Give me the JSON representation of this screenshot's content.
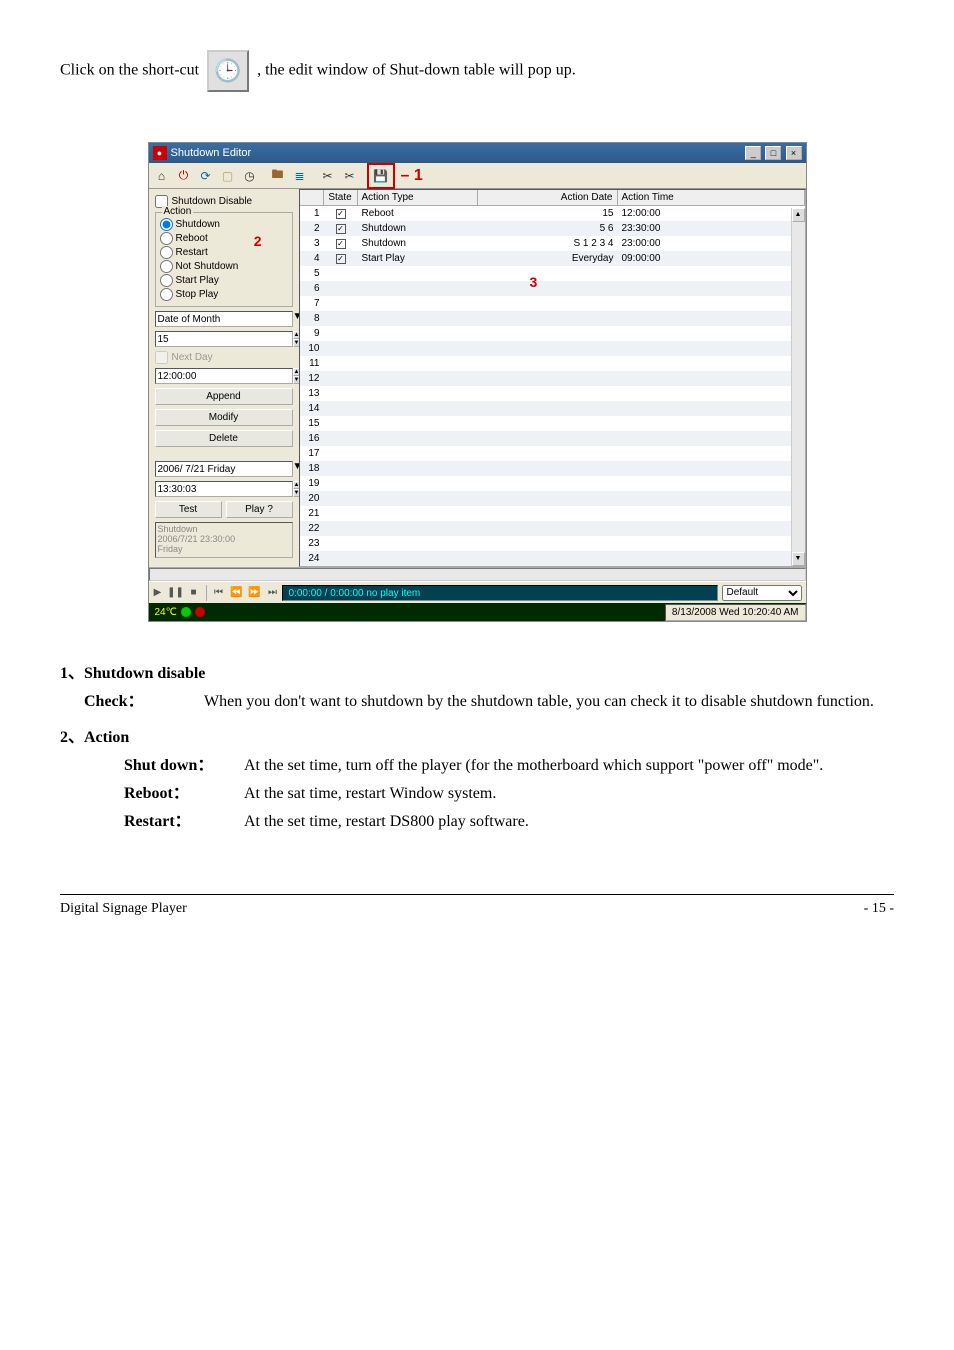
{
  "intro": {
    "prefix": "Click on the short-cut",
    "suffix": ", the edit window of Shut-down table will pop up."
  },
  "clock_icon_glyph": "🕒",
  "window": {
    "title": "Shutdown Editor",
    "toolbar_count": "1"
  },
  "left_panel": {
    "shutdown_disable": "Shutdown Disable",
    "action_legend": "Action",
    "radios": [
      {
        "label": "Shutdown",
        "checked": true
      },
      {
        "label": "Reboot",
        "checked": false
      },
      {
        "label": "Restart",
        "checked": false
      },
      {
        "label": "Not Shutdown",
        "checked": false
      },
      {
        "label": "Start Play",
        "checked": false
      },
      {
        "label": "Stop Play",
        "checked": false
      }
    ],
    "marker2": "2",
    "period_select": "Date of Month",
    "day_value": "15",
    "next_day": "Next Day",
    "time1": "12:00:00",
    "btn_append": "Append",
    "btn_modify": "Modify",
    "btn_delete": "Delete",
    "date_value": "2006/ 7/21 Friday",
    "time2": "13:30:03",
    "btn_test": "Test",
    "btn_play": "Play ?",
    "info1": "Shutdown",
    "info2": "2006/7/21  23:30:00",
    "info3": "Friday"
  },
  "grid": {
    "headers": {
      "state": "State",
      "action_type": "Action Type",
      "action_date": "Action Date",
      "action_time": "Action Time"
    },
    "rows": [
      {
        "n": 1,
        "chk": true,
        "type": "Reboot",
        "date": "15",
        "time": "12:00:00"
      },
      {
        "n": 2,
        "chk": true,
        "type": "Shutdown",
        "date": "5 6",
        "time": "23:30:00"
      },
      {
        "n": 3,
        "chk": true,
        "type": "Shutdown",
        "date": "S 1 2 3 4",
        "time": "23:00:00"
      },
      {
        "n": 4,
        "chk": true,
        "type": "Start Play",
        "date": "Everyday",
        "time": "09:00:00"
      },
      {
        "n": 5
      },
      {
        "n": 6
      },
      {
        "n": 7
      },
      {
        "n": 8
      },
      {
        "n": 9
      },
      {
        "n": 10
      },
      {
        "n": 11
      },
      {
        "n": 12
      },
      {
        "n": 13
      },
      {
        "n": 14
      },
      {
        "n": 15
      },
      {
        "n": 16
      },
      {
        "n": 17
      },
      {
        "n": 18
      },
      {
        "n": 19
      },
      {
        "n": 20
      },
      {
        "n": 21
      },
      {
        "n": 22
      },
      {
        "n": 23
      },
      {
        "n": 24
      }
    ],
    "marker3": "3"
  },
  "player": {
    "display": "0:00:00 / 0:00:00  no play item",
    "profile": "Default"
  },
  "status": {
    "temp": "24℃",
    "clock": "8/13/2008 Wed 10:20:40 AM"
  },
  "doc": {
    "h1": "1、Shutdown disable",
    "d1_label": "Check",
    "d1_body": "When you don't want to shutdown by the shutdown table, you can check it to disable shutdown function.",
    "h2": "2、Action",
    "d2a_label": "Shut down",
    "d2a_body": "At the set time, turn off the player (for the motherboard which support \"power off\" mode\".",
    "d2b_label": "Reboot",
    "d2b_body": "At the sat time, restart Window system.",
    "d2c_label": "Restart",
    "d2c_body": "At the set time, restart DS800 play software."
  },
  "footer": {
    "left": "Digital Signage Player",
    "right": "- 15 -"
  }
}
